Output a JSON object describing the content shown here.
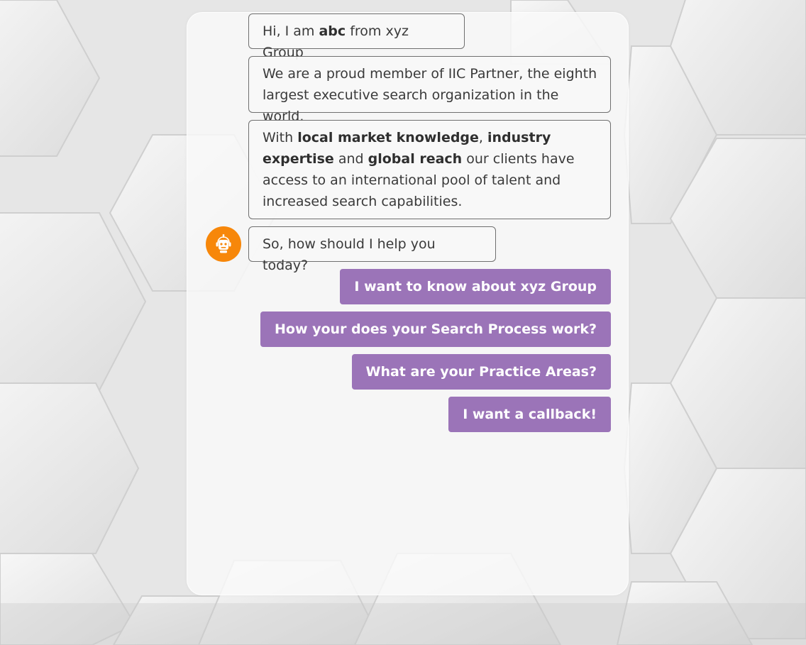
{
  "messages": {
    "greeting": {
      "pre": "Hi, I am ",
      "bold": "abc",
      "post": " from xyz Group"
    },
    "membership": "We are a proud member of IIC Partner, the eighth largest executive search organization in the world.",
    "reach": {
      "t1": "With ",
      "b1": "local market knowledge",
      "t2": ", ",
      "b2": "industry expertise",
      "t3": " and ",
      "b3": "global reach",
      "t4": " our clients have access to an international pool of talent and increased search capabilities."
    },
    "question": "So, how should I help you today?"
  },
  "bot": {
    "avatar_icon": "robot-icon",
    "avatar_color": "#f7870a"
  },
  "quick_replies": [
    {
      "label": "I want to know about xyz Group"
    },
    {
      "label": "How your does your Search Process work?"
    },
    {
      "label": "What are your Practice Areas?"
    },
    {
      "label": "I want a callback!"
    }
  ],
  "colors": {
    "quick_reply_bg": "#9b74b8",
    "bubble_border": "#6f6f6f",
    "text": "#3a3a3a"
  }
}
